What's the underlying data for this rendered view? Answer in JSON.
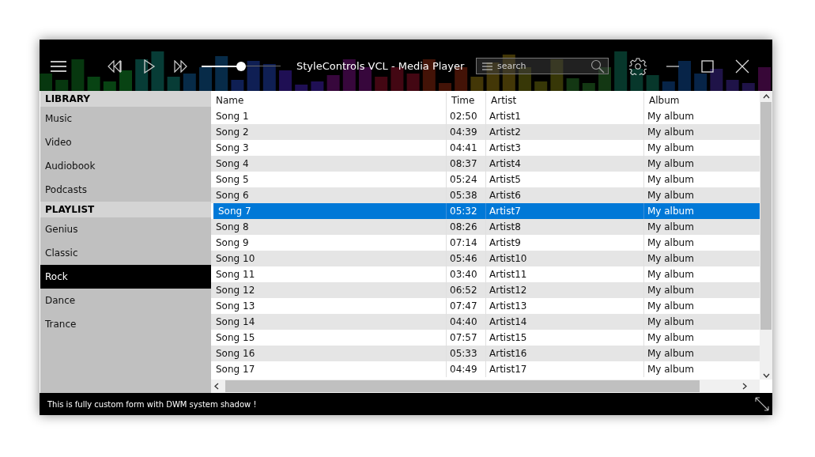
{
  "window": {
    "title": "StyleControls VCL - Media Player"
  },
  "toolbar": {
    "volume": {
      "level": 0.5
    },
    "search": {
      "placeholder": "search"
    }
  },
  "sidebar": {
    "sections": [
      {
        "header": "LIBRARY",
        "items": [
          {
            "label": "Music",
            "selected": false
          },
          {
            "label": "Video",
            "selected": false
          },
          {
            "label": "Audiobook",
            "selected": false
          },
          {
            "label": "Podcasts",
            "selected": false
          }
        ]
      },
      {
        "header": "PLAYLIST",
        "items": [
          {
            "label": "Genius",
            "selected": false
          },
          {
            "label": "Classic",
            "selected": false
          },
          {
            "label": "Rock",
            "selected": true
          },
          {
            "label": "Dance",
            "selected": false
          },
          {
            "label": "Trance",
            "selected": false
          }
        ]
      }
    ]
  },
  "table": {
    "columns": [
      "Name",
      "Time",
      "Artist",
      "Album"
    ],
    "rows": [
      {
        "cells": [
          "Song 1",
          "02:50",
          "Artist1",
          "My album"
        ],
        "selected": false
      },
      {
        "cells": [
          "Song 2",
          "04:39",
          "Artist2",
          "My album"
        ],
        "selected": false
      },
      {
        "cells": [
          "Song 3",
          "04:41",
          "Artist3",
          "My album"
        ],
        "selected": false
      },
      {
        "cells": [
          "Song 4",
          "08:37",
          "Artist4",
          "My album"
        ],
        "selected": false
      },
      {
        "cells": [
          "Song 5",
          "05:24",
          "Artist5",
          "My album"
        ],
        "selected": false
      },
      {
        "cells": [
          "Song 6",
          "05:38",
          "Artist6",
          "My album"
        ],
        "selected": false
      },
      {
        "cells": [
          "Song 7",
          "05:32",
          "Artist7",
          "My album"
        ],
        "selected": true
      },
      {
        "cells": [
          "Song 8",
          "08:26",
          "Artist8",
          "My album"
        ],
        "selected": false
      },
      {
        "cells": [
          "Song 9",
          "07:14",
          "Artist9",
          "My album"
        ],
        "selected": false
      },
      {
        "cells": [
          "Song 10",
          "05:46",
          "Artist10",
          "My album"
        ],
        "selected": false
      },
      {
        "cells": [
          "Song 11",
          "03:40",
          "Artist11",
          "My album"
        ],
        "selected": false
      },
      {
        "cells": [
          "Song 12",
          "06:52",
          "Artist12",
          "My album"
        ],
        "selected": false
      },
      {
        "cells": [
          "Song 13",
          "07:47",
          "Artist13",
          "My album"
        ],
        "selected": false
      },
      {
        "cells": [
          "Song 14",
          "04:40",
          "Artist14",
          "My album"
        ],
        "selected": false
      },
      {
        "cells": [
          "Song 15",
          "07:57",
          "Artist15",
          "My album"
        ],
        "selected": false
      },
      {
        "cells": [
          "Song 16",
          "05:33",
          "Artist16",
          "My album"
        ],
        "selected": false
      },
      {
        "cells": [
          "Song 17",
          "04:49",
          "Artist17",
          "My album"
        ],
        "selected": false
      }
    ]
  },
  "status_bar": {
    "text": "This is fully custom form with DWM system shadow !"
  }
}
